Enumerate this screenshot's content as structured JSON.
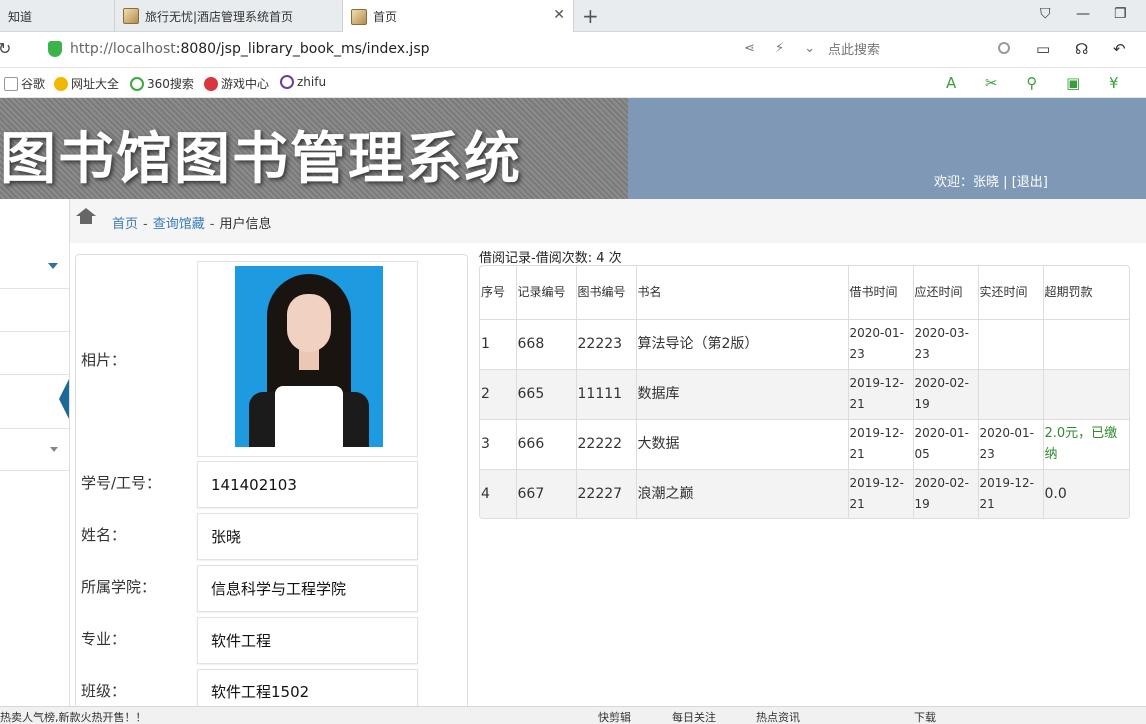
{
  "browser": {
    "tabs": [
      {
        "label": "知道"
      },
      {
        "label": "旅行无忧|酒店管理系统首页"
      },
      {
        "label": "首页"
      }
    ],
    "new_tab_icon": "+",
    "url_host": "http://localhost",
    "url_rest": ":8080/jsp_library_book_ms/index.jsp",
    "search_placeholder": "点此搜索",
    "bookmarks": [
      {
        "label": "谷歌"
      },
      {
        "label": "网址大全"
      },
      {
        "label": "360搜索"
      },
      {
        "label": "游戏中心"
      },
      {
        "label": "zhifu"
      }
    ]
  },
  "header": {
    "title": "图书馆图书管理系统",
    "welcome_prefix": "欢迎：",
    "username": "张晓",
    "divider": "|",
    "logout": "[退出]"
  },
  "breadcrumb": {
    "home": "首页",
    "sep": "-",
    "second": "查询馆藏",
    "current": "用户信息"
  },
  "user_info": {
    "photo_label": "相片：",
    "fields": [
      {
        "label": "学号/工号：",
        "value": "141402103"
      },
      {
        "label": "姓名：",
        "value": "张晓"
      },
      {
        "label": "所属学院：",
        "value": "信息科学与工程学院"
      },
      {
        "label": "专业：",
        "value": "软件工程"
      },
      {
        "label": "班级：",
        "value": "软件工程1502"
      }
    ]
  },
  "records": {
    "title": "借阅记录-借阅次数: 4 次",
    "columns": [
      "序号",
      "记录编号",
      "图书编号",
      "书名",
      "借书时间",
      "应还时间",
      "实还时间",
      "超期罚款"
    ],
    "rows": [
      {
        "no": "1",
        "record": "668",
        "book": "22223",
        "name": "算法导论（第2版）",
        "borrow": "2020-01-23",
        "due": "2020-03-23",
        "returned": "",
        "fine": ""
      },
      {
        "no": "2",
        "record": "665",
        "book": "11111",
        "name": "数据库",
        "borrow": "2019-12-21",
        "due": "2020-02-19",
        "returned": "",
        "fine": ""
      },
      {
        "no": "3",
        "record": "666",
        "book": "22222",
        "name": "大数据",
        "borrow": "2019-12-21",
        "due": "2020-01-05",
        "returned": "2020-01-23",
        "fine": "2.0元，已缴纳"
      },
      {
        "no": "4",
        "record": "667",
        "book": "22227",
        "name": "浪潮之巅",
        "borrow": "2019-12-21",
        "due": "2020-02-19",
        "returned": "2019-12-21",
        "fine": "0.0"
      }
    ]
  },
  "statusbar": {
    "left": "热卖人气榜,新款火热开售！！",
    "items": [
      "快剪辑",
      "每日关注",
      "热点资讯",
      "下载"
    ]
  },
  "colors": {
    "banner": "#7f98b6",
    "link": "#3a7cb8",
    "fine_paid": "#2e8b2e"
  }
}
